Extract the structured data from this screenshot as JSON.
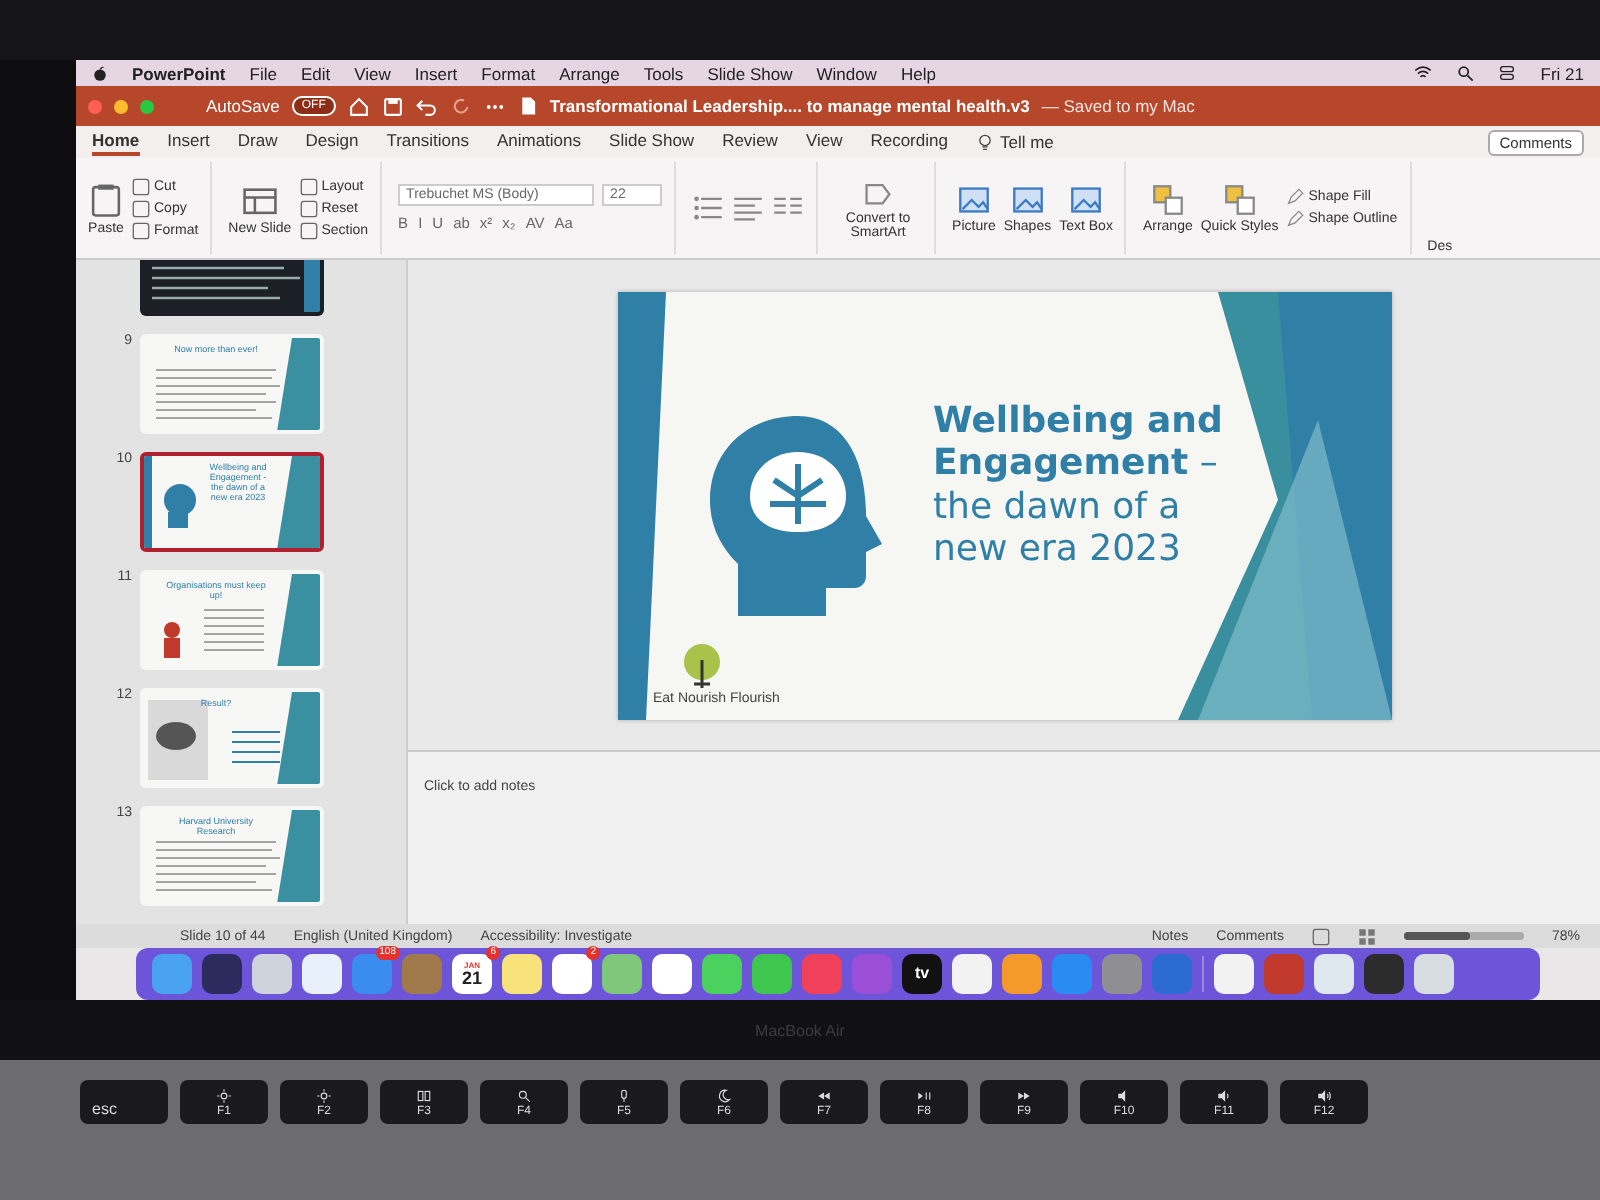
{
  "menu_bar": {
    "app": "PowerPoint",
    "items": [
      "File",
      "Edit",
      "View",
      "Insert",
      "Format",
      "Arrange",
      "Tools",
      "Slide Show",
      "Window",
      "Help"
    ],
    "clock": "Fri 21"
  },
  "title_bar": {
    "autosave": "AutoSave",
    "autosave_toggle": {
      "label": "OFF",
      "on": false
    },
    "document": "Transformational Leadership.... to manage mental health.v3",
    "saved": "— Saved to my Mac"
  },
  "ribbon_tabs": [
    {
      "label": "Home",
      "selected": true
    },
    {
      "label": "Insert",
      "selected": false
    },
    {
      "label": "Draw",
      "selected": false
    },
    {
      "label": "Design",
      "selected": false
    },
    {
      "label": "Transitions",
      "selected": false
    },
    {
      "label": "Animations",
      "selected": false
    },
    {
      "label": "Slide Show",
      "selected": false
    },
    {
      "label": "Review",
      "selected": false
    },
    {
      "label": "View",
      "selected": false
    },
    {
      "label": "Recording",
      "selected": false
    }
  ],
  "tell_me": "Tell me",
  "comments_button": "Comments",
  "ribbon": {
    "paste": "Paste",
    "clipboard": [
      "Cut",
      "Copy",
      "Format"
    ],
    "new_slide": "New Slide",
    "slide_actions": [
      "Layout",
      "Reset",
      "Section"
    ],
    "font": "Trebuchet MS (Body)",
    "font_size": "22",
    "format_buttons": [
      "B",
      "I",
      "U",
      "ab",
      "x²",
      "x₂",
      "AV",
      "Aa"
    ],
    "convert": "Convert to SmartArt",
    "insert": [
      "Picture",
      "Shapes",
      "Text Box"
    ],
    "arrange": [
      "Arrange",
      "Quick Styles"
    ],
    "shape_format": [
      "Shape Fill",
      "Shape Outline"
    ],
    "cut_off": "Des"
  },
  "thumbnails": [
    {
      "kind": "dark",
      "selected": false
    },
    {
      "kind": "text",
      "number": "9",
      "title": "Now more than ever!",
      "selected": false
    },
    {
      "kind": "head",
      "number": "10",
      "title": "Wellbeing and Engagement - the dawn of a new era 2023",
      "selected": true
    },
    {
      "kind": "figure",
      "number": "11",
      "title": "Organisations must keep up!",
      "selected": false
    },
    {
      "kind": "chart",
      "number": "12",
      "title": "Result?",
      "selected": false
    },
    {
      "kind": "text",
      "number": "13",
      "title": "Harvard University Research",
      "selected": false
    }
  ],
  "slide": {
    "title": "**Wellbeing and Engagement** – the dawn of a new era 2023",
    "logo": "Eat Nourish Flourish"
  },
  "notes": {
    "placeholder": "Click to add notes"
  },
  "status_bar": {
    "slide": "Slide 10 of 44",
    "language": "English (United Kingdom)",
    "accessibility": "Accessibility: Investigate",
    "notes": "Notes",
    "comments": "Comments",
    "zoom": {
      "level": 0.55,
      "reading": "78%"
    }
  },
  "dock": [
    {
      "kind": "finder"
    },
    {
      "kind": "siri"
    },
    {
      "kind": "launchpad"
    },
    {
      "kind": "safari"
    },
    {
      "kind": "mail",
      "badge": "108"
    },
    {
      "kind": "contacts"
    },
    {
      "kind": "calendar",
      "month": "JAN",
      "day": "21",
      "badge": "6"
    },
    {
      "kind": "notes"
    },
    {
      "kind": "reminders",
      "badge": "2"
    },
    {
      "kind": "maps"
    },
    {
      "kind": "photos"
    },
    {
      "kind": "messages"
    },
    {
      "kind": "facetime"
    },
    {
      "kind": "music"
    },
    {
      "kind": "podcasts"
    },
    {
      "kind": "tv",
      "label": "tv"
    },
    {
      "kind": "news"
    },
    {
      "kind": "books"
    },
    {
      "kind": "appstore"
    },
    {
      "kind": "settings"
    },
    {
      "kind": "word"
    },
    {
      "kind": "sep"
    },
    {
      "kind": "chrome"
    },
    {
      "kind": "app"
    },
    {
      "kind": "preview"
    },
    {
      "kind": "device"
    },
    {
      "kind": "trash"
    }
  ],
  "laptop": {
    "brand": "MacBook Air",
    "keys": [
      {
        "label": "esc",
        "kind": "esc"
      },
      {
        "label": "F1",
        "kind": "sun"
      },
      {
        "label": "F2",
        "kind": "sun"
      },
      {
        "label": "F3",
        "kind": "windows"
      },
      {
        "label": "F4",
        "kind": "search"
      },
      {
        "label": "F5",
        "kind": "mic"
      },
      {
        "label": "F6",
        "kind": "moon"
      },
      {
        "label": "F7",
        "kind": "rewind"
      },
      {
        "label": "F8",
        "kind": "play"
      },
      {
        "label": "F9",
        "kind": "forward"
      },
      {
        "label": "F10",
        "kind": "mute"
      },
      {
        "label": "F11",
        "kind": "voldown"
      },
      {
        "label": "F12",
        "kind": "volup"
      }
    ]
  }
}
